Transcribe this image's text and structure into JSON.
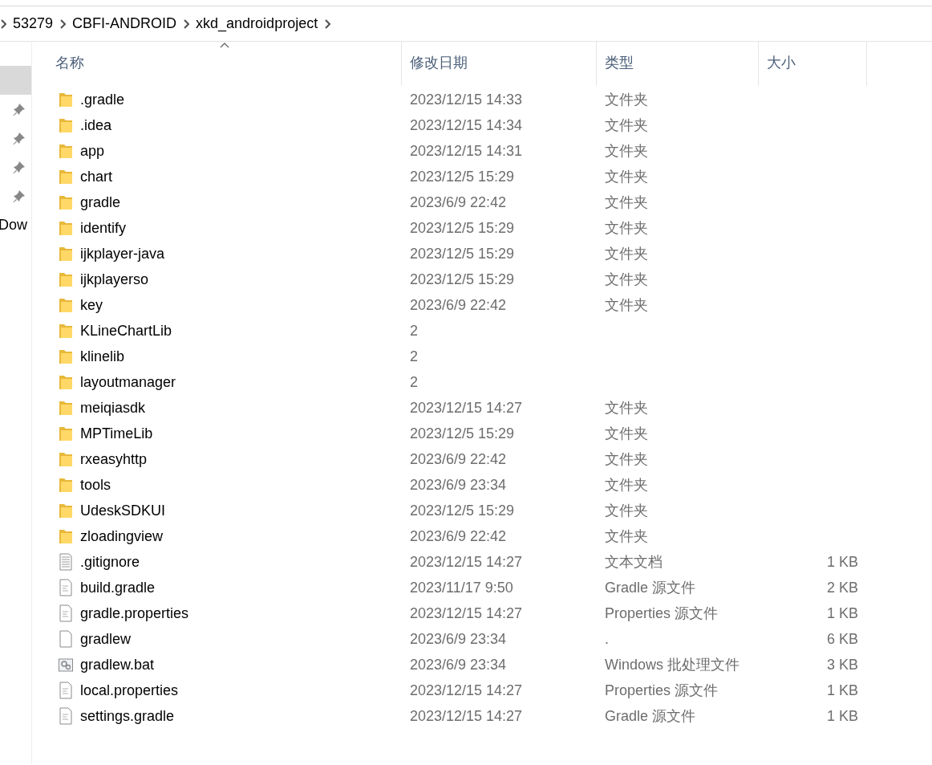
{
  "breadcrumb": [
    "53279",
    "CBFI-ANDROID",
    "xkd_androidproject"
  ],
  "sidebar": {
    "items": [
      {
        "kind": "blank",
        "selected": true
      },
      {
        "kind": "pin",
        "selected": false
      },
      {
        "kind": "pin",
        "selected": false
      },
      {
        "kind": "pin",
        "selected": false
      },
      {
        "kind": "pin",
        "selected": false
      },
      {
        "kind": "label",
        "label": "Dow",
        "selected": false
      }
    ]
  },
  "table": {
    "columns": [
      {
        "label": "名称",
        "sorted": true
      },
      {
        "label": "修改日期",
        "sorted": false
      },
      {
        "label": "类型",
        "sorted": false
      },
      {
        "label": "大小",
        "sorted": false
      }
    ],
    "rows": [
      {
        "kind": "folder",
        "name": ".gradle",
        "date": "2023/12/15 14:33",
        "type": "文件夹"
      },
      {
        "kind": "folder",
        "name": ".idea",
        "date": "2023/12/15 14:34",
        "type": "文件夹"
      },
      {
        "kind": "folder",
        "name": "app",
        "date": "2023/12/15 14:31",
        "type": "文件夹"
      },
      {
        "kind": "folder",
        "name": "chart",
        "date": "2023/12/5 15:29",
        "type": "文件夹"
      },
      {
        "kind": "folder",
        "name": "gradle",
        "date": "2023/6/9 22:42",
        "type": "文件夹"
      },
      {
        "kind": "folder",
        "name": "identify",
        "date": "2023/12/5 15:29",
        "type": "文件夹"
      },
      {
        "kind": "folder",
        "name": "ijkplayer-java",
        "date": "2023/12/5 15:29",
        "type": "文件夹"
      },
      {
        "kind": "folder",
        "name": "ijkplayerso",
        "date": "2023/12/5 15:29",
        "type": "文件夹"
      },
      {
        "kind": "folder",
        "name": "key",
        "date": "2023/6/9 22:42",
        "type": "文件夹"
      },
      {
        "kind": "folder",
        "name": "KLineChartLib",
        "date": "2"
      },
      {
        "kind": "folder",
        "name": "klinelib",
        "date": "2"
      },
      {
        "kind": "folder",
        "name": "layoutmanager",
        "date": "2"
      },
      {
        "kind": "folder",
        "name": "meiqiasdk",
        "date": "2023/12/15 14:27",
        "type": "文件夹"
      },
      {
        "kind": "folder",
        "name": "MPTimeLib",
        "date": "2023/12/5 15:29",
        "type": "文件夹"
      },
      {
        "kind": "folder",
        "name": "rxeasyhttp",
        "date": "2023/6/9 22:42",
        "type": "文件夹"
      },
      {
        "kind": "folder",
        "name": "tools",
        "date": "2023/6/9 23:34",
        "type": "文件夹"
      },
      {
        "kind": "folder",
        "name": "UdeskSDKUI",
        "date": "2023/12/5 15:29",
        "type": "文件夹"
      },
      {
        "kind": "folder",
        "name": "zloadingview",
        "date": "2023/6/9 22:42",
        "type": "文件夹"
      },
      {
        "kind": "text",
        "name": ".gitignore",
        "date": "2023/12/15 14:27",
        "type": "文本文档",
        "size": "1 KB"
      },
      {
        "kind": "source",
        "name": "build.gradle",
        "date": "2023/11/17 9:50",
        "type": "Gradle 源文件",
        "size": "2 KB"
      },
      {
        "kind": "source",
        "name": "gradle.properties",
        "date": "2023/12/15 14:27",
        "type": "Properties 源文件",
        "size": "1 KB"
      },
      {
        "kind": "blank",
        "name": "gradlew",
        "date": "2023/6/9 23:34",
        "type": ".",
        "size": "6 KB"
      },
      {
        "kind": "batch",
        "name": "gradlew.bat",
        "date": "2023/6/9 23:34",
        "type": "Windows 批处理文件",
        "size": "3 KB"
      },
      {
        "kind": "source",
        "name": "local.properties",
        "date": "2023/12/15 14:27",
        "type": "Properties 源文件",
        "size": "1 KB"
      },
      {
        "kind": "source",
        "name": "settings.gradle",
        "date": "2023/12/15 14:27",
        "type": "Gradle 源文件",
        "size": "1 KB"
      }
    ]
  }
}
